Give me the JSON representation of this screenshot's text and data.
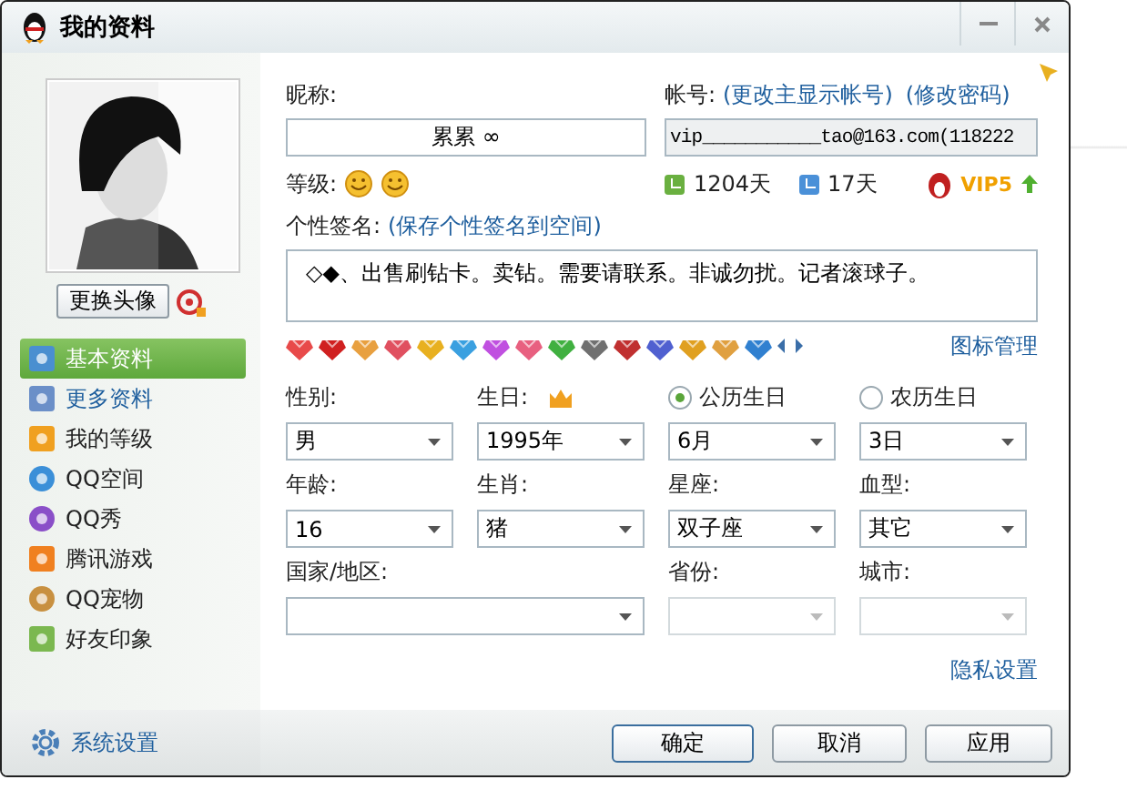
{
  "window": {
    "title": "我的资料"
  },
  "avatar": {
    "change_button": "更换头像"
  },
  "nav": [
    {
      "label": "基本资料",
      "selected": true
    },
    {
      "label": "更多资料",
      "selected": false
    },
    {
      "label": "我的等级",
      "selected": false
    },
    {
      "label": "QQ空间",
      "selected": false
    },
    {
      "label": "QQ秀",
      "selected": false
    },
    {
      "label": "腾讯游戏",
      "selected": false
    },
    {
      "label": "QQ宠物",
      "selected": false
    },
    {
      "label": "好友印象",
      "selected": false
    }
  ],
  "settings_link": "系统设置",
  "nickname": {
    "label": "昵称:",
    "value": "累累 ∞"
  },
  "account": {
    "label": "帐号:",
    "links": [
      "(更改主显示帐号)",
      "(修改密码)"
    ],
    "value": "vip___________tao@163.com(118222"
  },
  "level": {
    "label": "等级:",
    "days_online": "1204天",
    "days_remaining": "17天",
    "vip": "VIP5"
  },
  "signature": {
    "label": "个性签名:",
    "link": "(保存个性签名到空间)",
    "value": "◇◆、出售刷钻卡。卖钻。需要请联系。非诚勿扰。记者滚球子。"
  },
  "icon_manage": "图标管理",
  "fields": [
    {
      "label": "性别:",
      "value": "男",
      "disabled": false
    },
    {
      "label": "生日:",
      "value": "1995年",
      "disabled": false,
      "kind": "birthday"
    },
    {
      "label": "公历生日",
      "value": "6月",
      "disabled": false,
      "kind": "radio",
      "selected": true
    },
    {
      "label": "农历生日",
      "value": "3日",
      "disabled": false,
      "kind": "radio",
      "selected": false
    },
    {
      "label": "年龄:",
      "value": "16",
      "disabled": false
    },
    {
      "label": "生肖:",
      "value": "猪",
      "disabled": false
    },
    {
      "label": "星座:",
      "value": "双子座",
      "disabled": false
    },
    {
      "label": "血型:",
      "value": "其它",
      "disabled": false
    },
    {
      "label": "国家/地区:",
      "disabled": false,
      "kind": "wide"
    },
    {
      "label": "省份:",
      "disabled": true
    },
    {
      "label": "城市:",
      "disabled": true
    }
  ],
  "privacy_link": "隐私设置",
  "buttons": [
    {
      "label": "确定",
      "default": true
    },
    {
      "label": "取消",
      "default": false
    },
    {
      "label": "应用",
      "default": false
    }
  ]
}
